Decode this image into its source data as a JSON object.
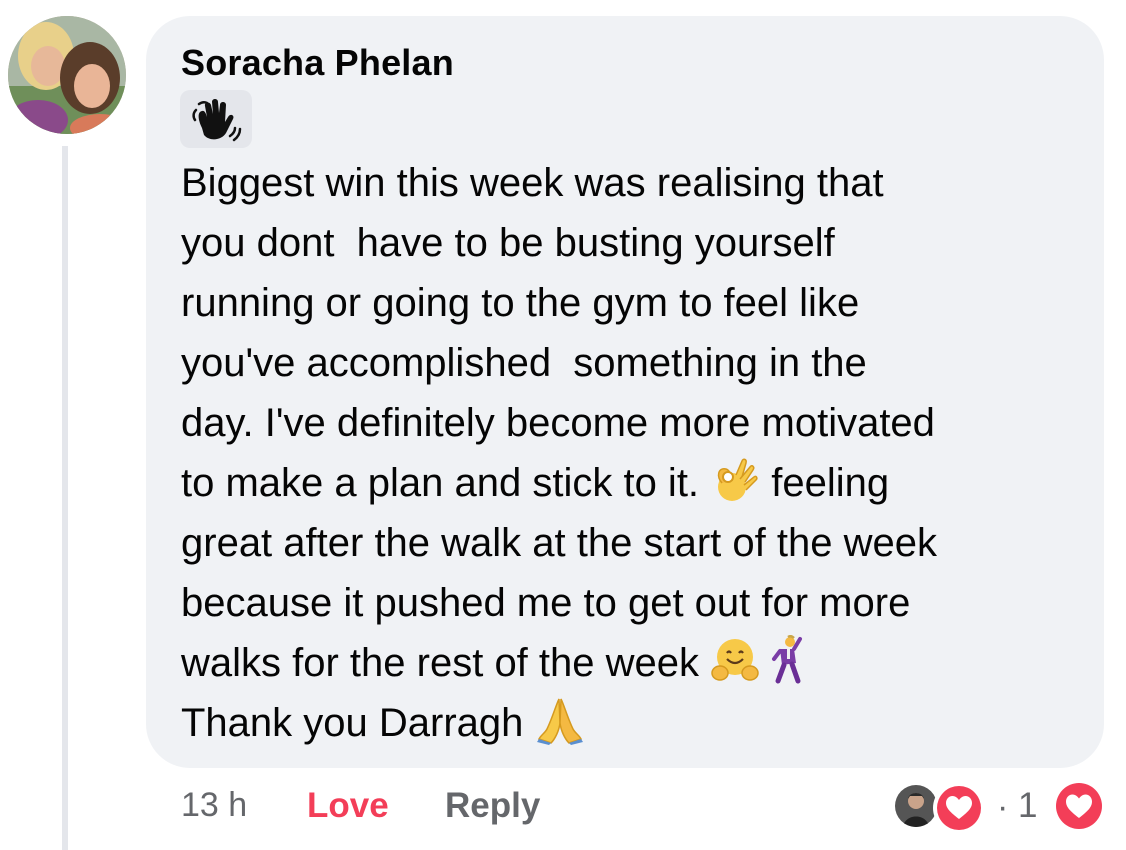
{
  "comment": {
    "author": "Soracha Phelan",
    "badge_icon": "waving-hand-icon",
    "text_lines": [
      "Biggest win this week was realising that",
      "you dont  have to be busting yourself",
      "running or going to the gym to feel like",
      "you've accomplished  something in the",
      "day. I've definitely become more motivated"
    ],
    "line6_before": "to make a plan and stick to it. ",
    "line6_after": " feeling",
    "line7": "great after the walk at the start of the week",
    "line8": "because it pushed me to get out for more",
    "line9": "walks for the rest of the week ",
    "line10": "Thank you Darragh ",
    "emojis": [
      "ok-hand-icon",
      "hugging-face-icon",
      "man-dancing-icon",
      "folded-hands-icon"
    ]
  },
  "actions": {
    "timestamp": "13 h",
    "love_label": "Love",
    "reply_label": "Reply",
    "separator": "·",
    "reaction_count": "1",
    "reaction_icon": "heart-icon"
  },
  "colors": {
    "love": "#f33e58",
    "muted": "#65676b",
    "bubble": "#f0f2f5"
  }
}
